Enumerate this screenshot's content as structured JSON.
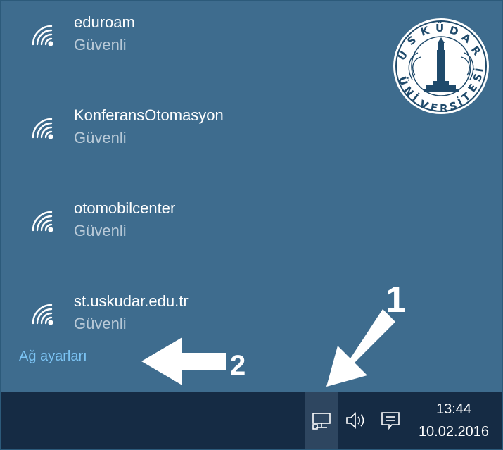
{
  "networks": [
    {
      "ssid": "eduroam",
      "security": "Güvenli",
      "icon": "wifi-icon"
    },
    {
      "ssid": "KonferansOtomasyon",
      "security": "Güvenli",
      "icon": "wifi-icon"
    },
    {
      "ssid": "otomobilcenter",
      "security": "Güvenli",
      "icon": "wifi-icon"
    },
    {
      "ssid": "st.uskudar.edu.tr",
      "security": "Güvenli",
      "icon": "wifi-icon"
    }
  ],
  "settings_link": "Ağ ayarları",
  "logo": {
    "text": "ÜSKÜDAR ÜNİVERSİTESİ"
  },
  "annotations": {
    "arrow1": "1",
    "arrow2": "2"
  },
  "taskbar": {
    "time": "13:44",
    "date": "10.02.2016",
    "icons": [
      "network-icon",
      "volume-icon",
      "action-center-icon"
    ]
  },
  "colors": {
    "flyout_bg": "#3e6c8e",
    "taskbar_bg": "#152b44",
    "link": "#7cc4f4",
    "secondary_text": "#b9cad8"
  }
}
